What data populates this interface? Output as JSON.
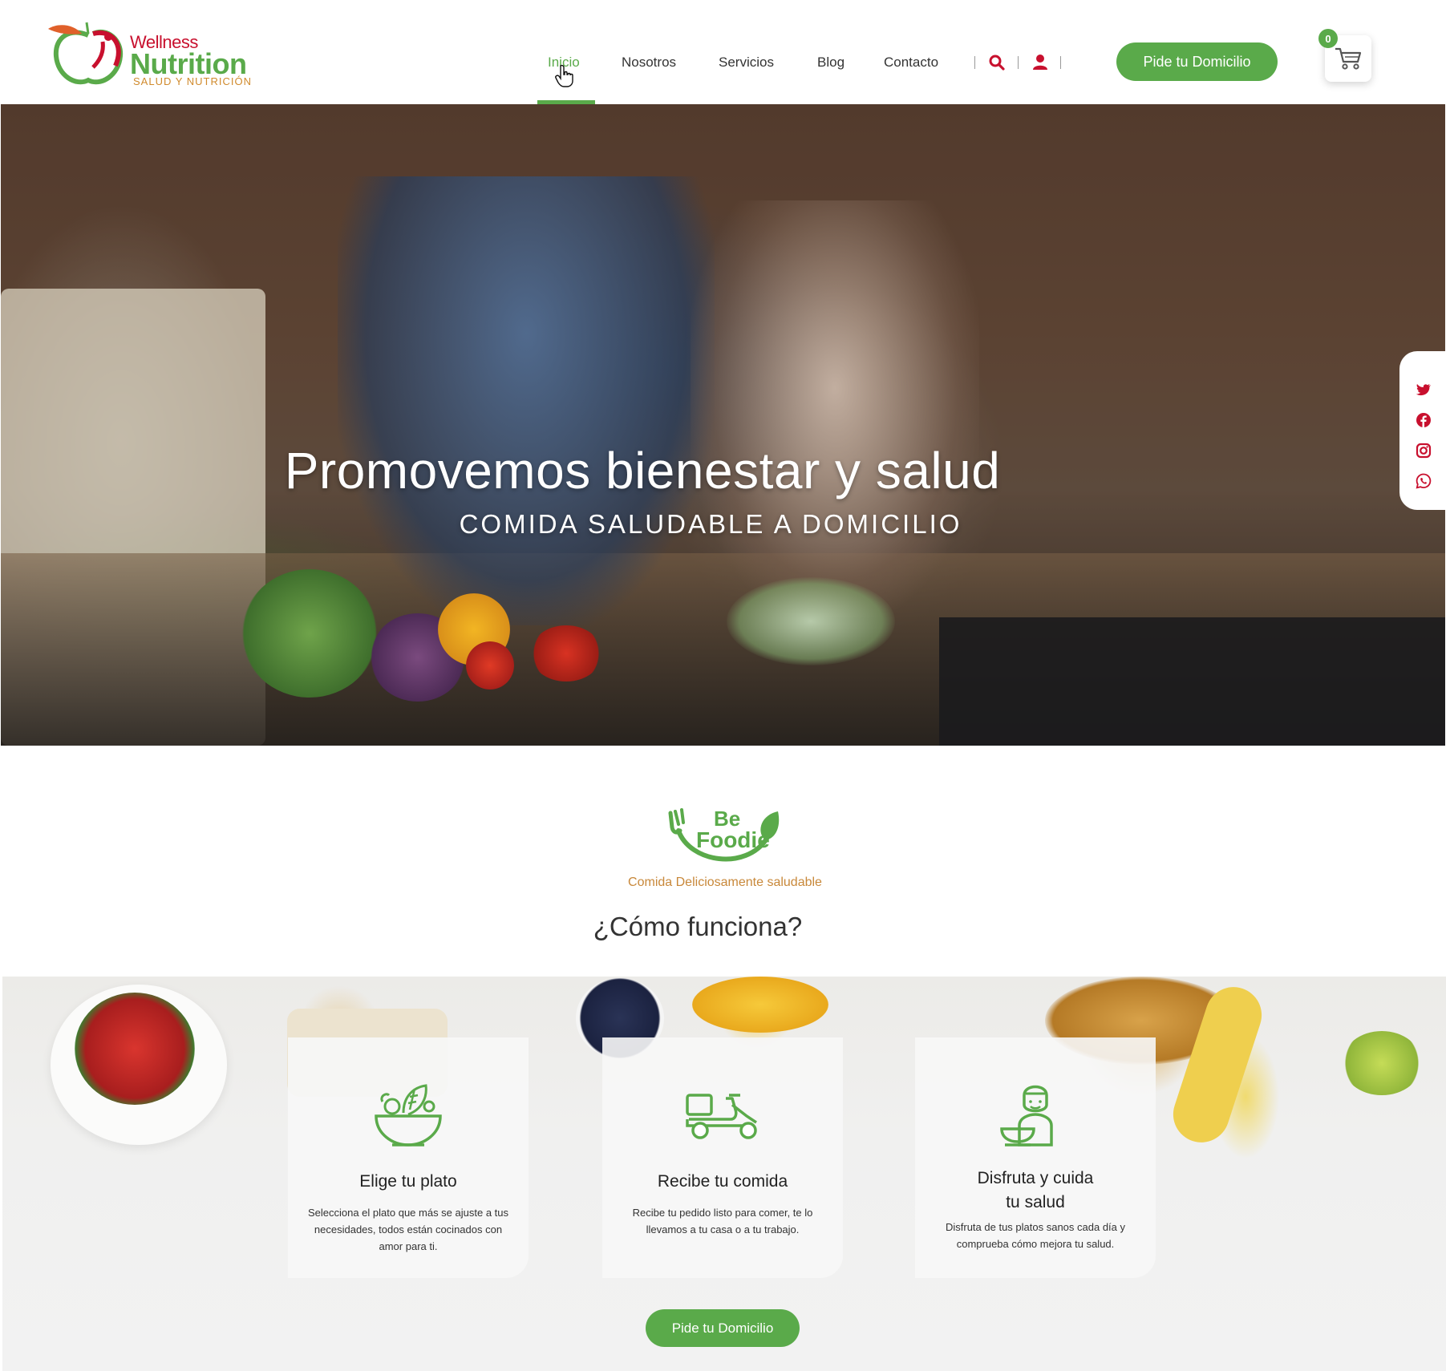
{
  "brand": {
    "name_line1": "Wellness",
    "name_line2": "Nutrition",
    "tagline": "SALUD Y NUTRICIÓN"
  },
  "nav": {
    "items": [
      {
        "label": "Inicio",
        "active": true
      },
      {
        "label": "Nosotros",
        "active": false
      },
      {
        "label": "Servicios",
        "active": false
      },
      {
        "label": "Blog",
        "active": false
      },
      {
        "label": "Contacto",
        "active": false
      }
    ],
    "cta_label": "Pide tu Domicilio",
    "cart_count": "0"
  },
  "hero": {
    "title": "Promovemos bienestar y salud",
    "subtitle": "COMIDA SALUDABLE A DOMICILIO"
  },
  "social": [
    "twitter-icon",
    "facebook-icon",
    "instagram-icon",
    "whatsapp-icon"
  ],
  "section": {
    "badge_line1": "Be",
    "badge_line2": "Foodie",
    "badge_tagline": "Comida Deliciosamente saludable",
    "heading": "¿Cómo funciona?"
  },
  "steps": [
    {
      "icon": "salad-bowl-icon",
      "title": "Elige tu plato",
      "description": "Selecciona el plato que más se ajuste a tus necesidades, todos están cocinados con amor para ti."
    },
    {
      "icon": "delivery-scooter-icon",
      "title": "Recibe tu  comida",
      "description": "Recibe tu pedido listo para comer, te lo llevamos a tu casa o a tu trabajo."
    },
    {
      "icon": "chef-icon",
      "title_line1": "Disfruta  y cuida",
      "title_line2": "tu salud",
      "description": "Disfruta de tus platos sanos cada día y comprueba cómo mejora tu salud."
    }
  ],
  "bottom_cta_label": "Pide tu Domicilio",
  "colors": {
    "accent": "#5aaa4a",
    "brand_red": "#c8102e",
    "brand_orange": "#d08a2c"
  }
}
